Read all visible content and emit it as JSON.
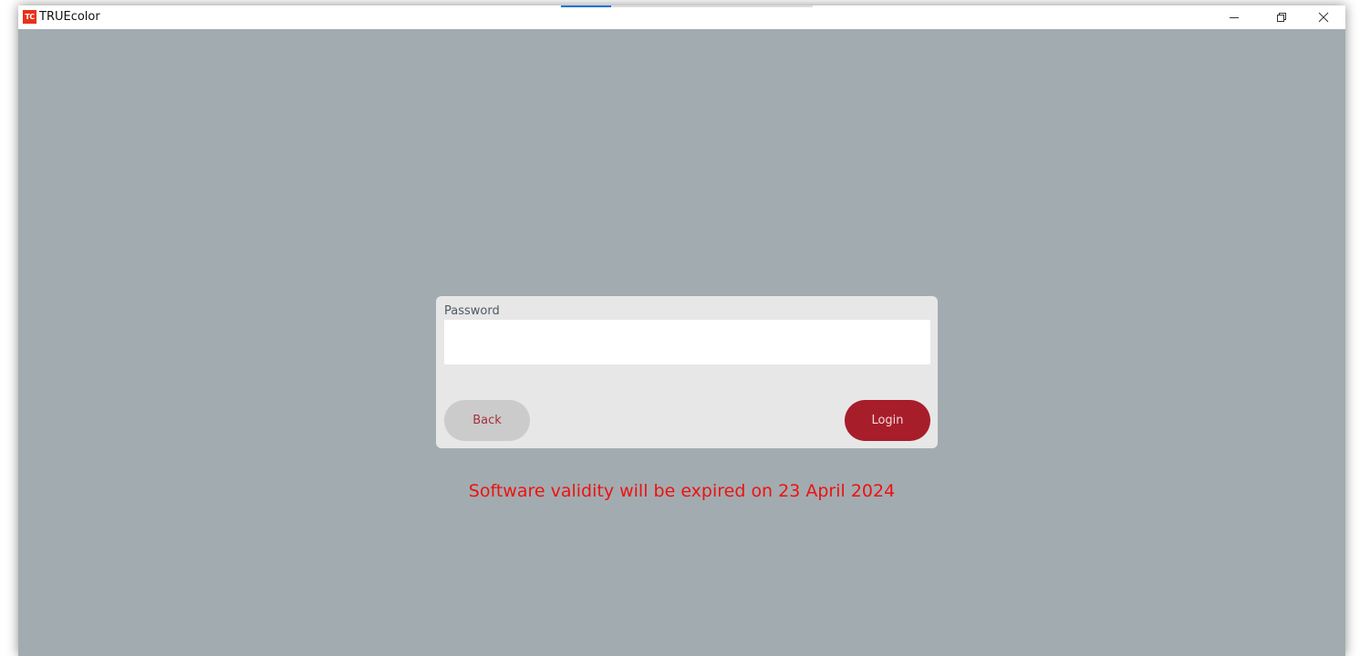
{
  "window": {
    "title": "TRUEcolor",
    "icon_text": "TC",
    "icon_color": "#e8311a",
    "loading_progress": 0.2
  },
  "login": {
    "password_label": "Password",
    "password_value": "",
    "back_label": "Back",
    "login_label": "Login"
  },
  "notice": {
    "validity_text": "Software validity will be expired on 23 April 2024",
    "color": "#ee1111"
  },
  "colors": {
    "background": "#a2acb0",
    "card": "#e7e7e7",
    "login_button": "#a81d2a",
    "back_button": "#cbcbcb"
  }
}
